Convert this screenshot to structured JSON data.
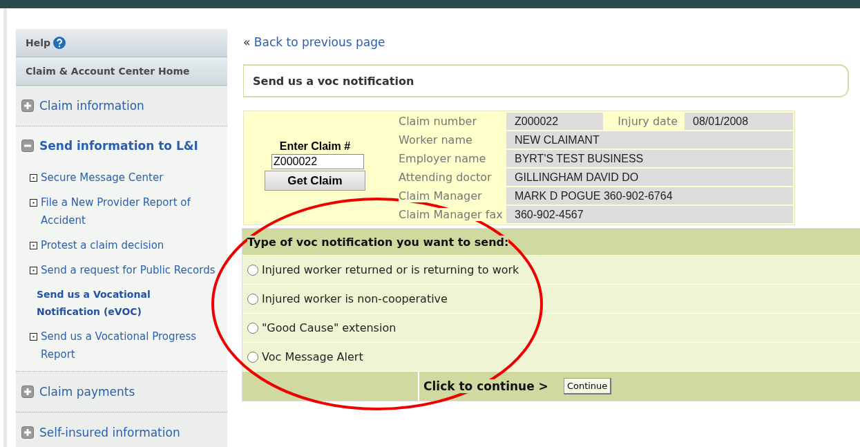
{
  "sidebar": {
    "help": "Help",
    "home": "Claim & Account Center Home",
    "sections": [
      {
        "label": "Claim information",
        "expanded": false
      },
      {
        "label": "Send information to L&I",
        "expanded": true,
        "children": [
          {
            "label": "Secure Message Center",
            "selected": false
          },
          {
            "label": "File a New Provider Report of Accident",
            "selected": false
          },
          {
            "label": "Protest a claim decision",
            "selected": false
          },
          {
            "label": "Send a request for Public Records",
            "selected": false
          },
          {
            "label": "Send us a Vocational Notification (eVOC)",
            "selected": true
          },
          {
            "label": "Send us a Vocational Progress Report",
            "selected": false
          }
        ]
      },
      {
        "label": "Claim payments",
        "expanded": false
      },
      {
        "label": "Self-insured information",
        "expanded": false
      }
    ]
  },
  "back_link": {
    "arrow": "«",
    "label": "Back to previous page"
  },
  "page_title": "Send us a voc notification",
  "claim_lookup": {
    "label": "Enter Claim #",
    "value": "Z000022",
    "button": "Get Claim"
  },
  "claim_details": [
    {
      "label": "Claim number",
      "value": "Z000022",
      "extra_label": "Injury date",
      "extra_value": "08/01/2008"
    },
    {
      "label": "Worker name",
      "value": "NEW CLAIMANT"
    },
    {
      "label": "Employer name",
      "value": "BYRT'S TEST BUSINESS"
    },
    {
      "label": "Attending doctor",
      "value": "GILLINGHAM DAVID DO"
    },
    {
      "label": "Claim Manager",
      "value": "MARK D POGUE 360-902-6764"
    },
    {
      "label": "Claim Manager fax",
      "value": "360-902-4567"
    }
  ],
  "notification_form": {
    "question": "Type of voc notification you want to send:",
    "options": [
      {
        "label": "Injured worker returned or is returning to work",
        "selected": false
      },
      {
        "label": "Injured worker is non-cooperative",
        "selected": false
      },
      {
        "label": "\"Good Cause\" extension",
        "selected": false
      },
      {
        "label": "Voc Message Alert",
        "selected": false
      }
    ],
    "continue_label": "Click to continue >",
    "continue_button": "Continue"
  }
}
